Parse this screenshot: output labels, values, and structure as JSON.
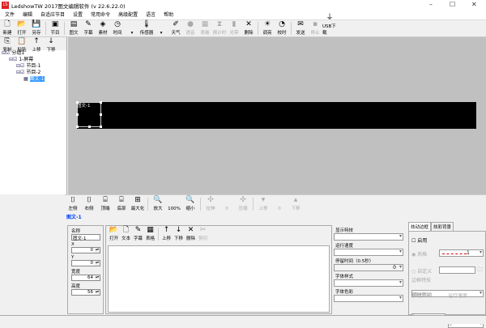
{
  "window": {
    "title": "LedshowTW 2017图文编辑软件 (v 22.6.22.0)",
    "logo": "LS",
    "minimize": "–",
    "maximize": "☐",
    "close": "✕"
  },
  "menu": [
    "文件",
    "编辑",
    "自适应节目",
    "设置",
    "常用命令",
    "高级配置",
    "语言",
    "帮助"
  ],
  "toolbar": [
    {
      "label": "新建",
      "icon": "🗋"
    },
    {
      "label": "打开",
      "icon": "📂"
    },
    {
      "label": "另存",
      "icon": "💾"
    },
    {
      "sep": true
    },
    {
      "label": "节目",
      "icon": "▣"
    },
    {
      "sep": true
    },
    {
      "label": "图文",
      "icon": "▤"
    },
    {
      "label": "字幕",
      "icon": "✎"
    },
    {
      "label": "素材",
      "icon": "◈"
    },
    {
      "label": "时间",
      "icon": "◷"
    },
    {
      "label": "▾",
      "icon": ""
    },
    {
      "label": "传感器",
      "icon": "🌡"
    },
    {
      "label": "▾",
      "icon": ""
    },
    {
      "label": "天气",
      "icon": "✐"
    },
    {
      "label": "语音",
      "icon": "●",
      "disabled": true
    },
    {
      "label": "表格",
      "icon": "▦",
      "disabled": true
    },
    {
      "label": "倒计时",
      "icon": "⧗",
      "disabled": true
    },
    {
      "label": "光带",
      "icon": "▮",
      "disabled": true
    },
    {
      "label": "删除",
      "icon": "✕"
    },
    {
      "sep": true
    },
    {
      "label": "调亮",
      "icon": "☀"
    },
    {
      "label": "校时",
      "icon": "◔"
    },
    {
      "sep": true
    },
    {
      "label": "发送",
      "icon": "✉"
    },
    {
      "label": "停止",
      "icon": "▪",
      "disabled": true
    },
    {
      "label": "USB下载",
      "icon": "⏚"
    }
  ],
  "left_toolbar": [
    {
      "label": "复制",
      "icon": "⎘"
    },
    {
      "label": "粘贴",
      "icon": "📋"
    },
    {
      "label": "上移",
      "icon": "↑"
    },
    {
      "label": "下移",
      "icon": "↓"
    }
  ],
  "tree": [
    {
      "label": "分组1",
      "indent": 0
    },
    {
      "label": "1-屏幕",
      "indent": 1
    },
    {
      "label": "节目-1",
      "indent": 2
    },
    {
      "label": "节目-2",
      "indent": 2
    },
    {
      "label": "图文-1",
      "indent": 3,
      "selected": true
    }
  ],
  "canvas": {
    "area_label": "图文-1"
  },
  "bottom_toolbar": [
    {
      "label": "左侧",
      "icon": "⌷"
    },
    {
      "label": "右侧",
      "icon": "⌷"
    },
    {
      "label": "顶端",
      "icon": "⌸"
    },
    {
      "label": "底部",
      "icon": "⌸"
    },
    {
      "label": "最大化",
      "icon": "⊞"
    },
    {
      "sep": true
    },
    {
      "label": "放大",
      "icon": "🔍"
    },
    {
      "label": "100%",
      "icon": ""
    },
    {
      "label": "缩小",
      "icon": "🔍"
    },
    {
      "sep": true
    },
    {
      "label": "拉伸",
      "icon": "✣",
      "disabled": true
    },
    {
      "label": "0",
      "icon": "",
      "disabled": true
    },
    {
      "label": "压缩",
      "icon": "✣",
      "disabled": true
    },
    {
      "sep": true
    },
    {
      "label": "上移",
      "icon": "▾",
      "disabled": true
    },
    {
      "label": "0",
      "icon": "",
      "disabled": true
    },
    {
      "label": "下移",
      "icon": "▴",
      "disabled": true
    }
  ],
  "selected_object": "图文-1",
  "props": {
    "name_label": "名称",
    "name": "图文-1",
    "x_label": "X",
    "x": "0",
    "y_label": "Y",
    "y": "0",
    "w_label": "宽度",
    "w": "64",
    "h_label": "高度",
    "h": "56"
  },
  "content_toolbar": [
    {
      "label": "打开",
      "icon": "📂"
    },
    {
      "label": "文本",
      "icon": "🗋"
    },
    {
      "label": "字幕",
      "icon": "✎"
    },
    {
      "label": "表格",
      "icon": "▦"
    },
    {
      "sep": true
    },
    {
      "label": "上移",
      "icon": "↑"
    },
    {
      "label": "下移",
      "icon": "↓"
    },
    {
      "label": "删除",
      "icon": "✕"
    },
    {
      "label": "剪切",
      "icon": "✂",
      "disabled": true
    }
  ],
  "format": {
    "display": "显示特技",
    "speed": "运行速度",
    "stay": "停留时间（0.5秒）",
    "stay_value": "0",
    "font_style": "字体样式",
    "font_color": "字体色彩"
  },
  "border": {
    "tabs": [
      "炫动边框",
      "炫彩背景"
    ],
    "enable": "启用",
    "style": "风格",
    "style_value": "1",
    "custom": "自定义",
    "effect_label": "边框特技",
    "effect": "顺时转动",
    "step_label": "移动步长",
    "step": "1",
    "speed_label": "运行速度",
    "speed": "5"
  }
}
